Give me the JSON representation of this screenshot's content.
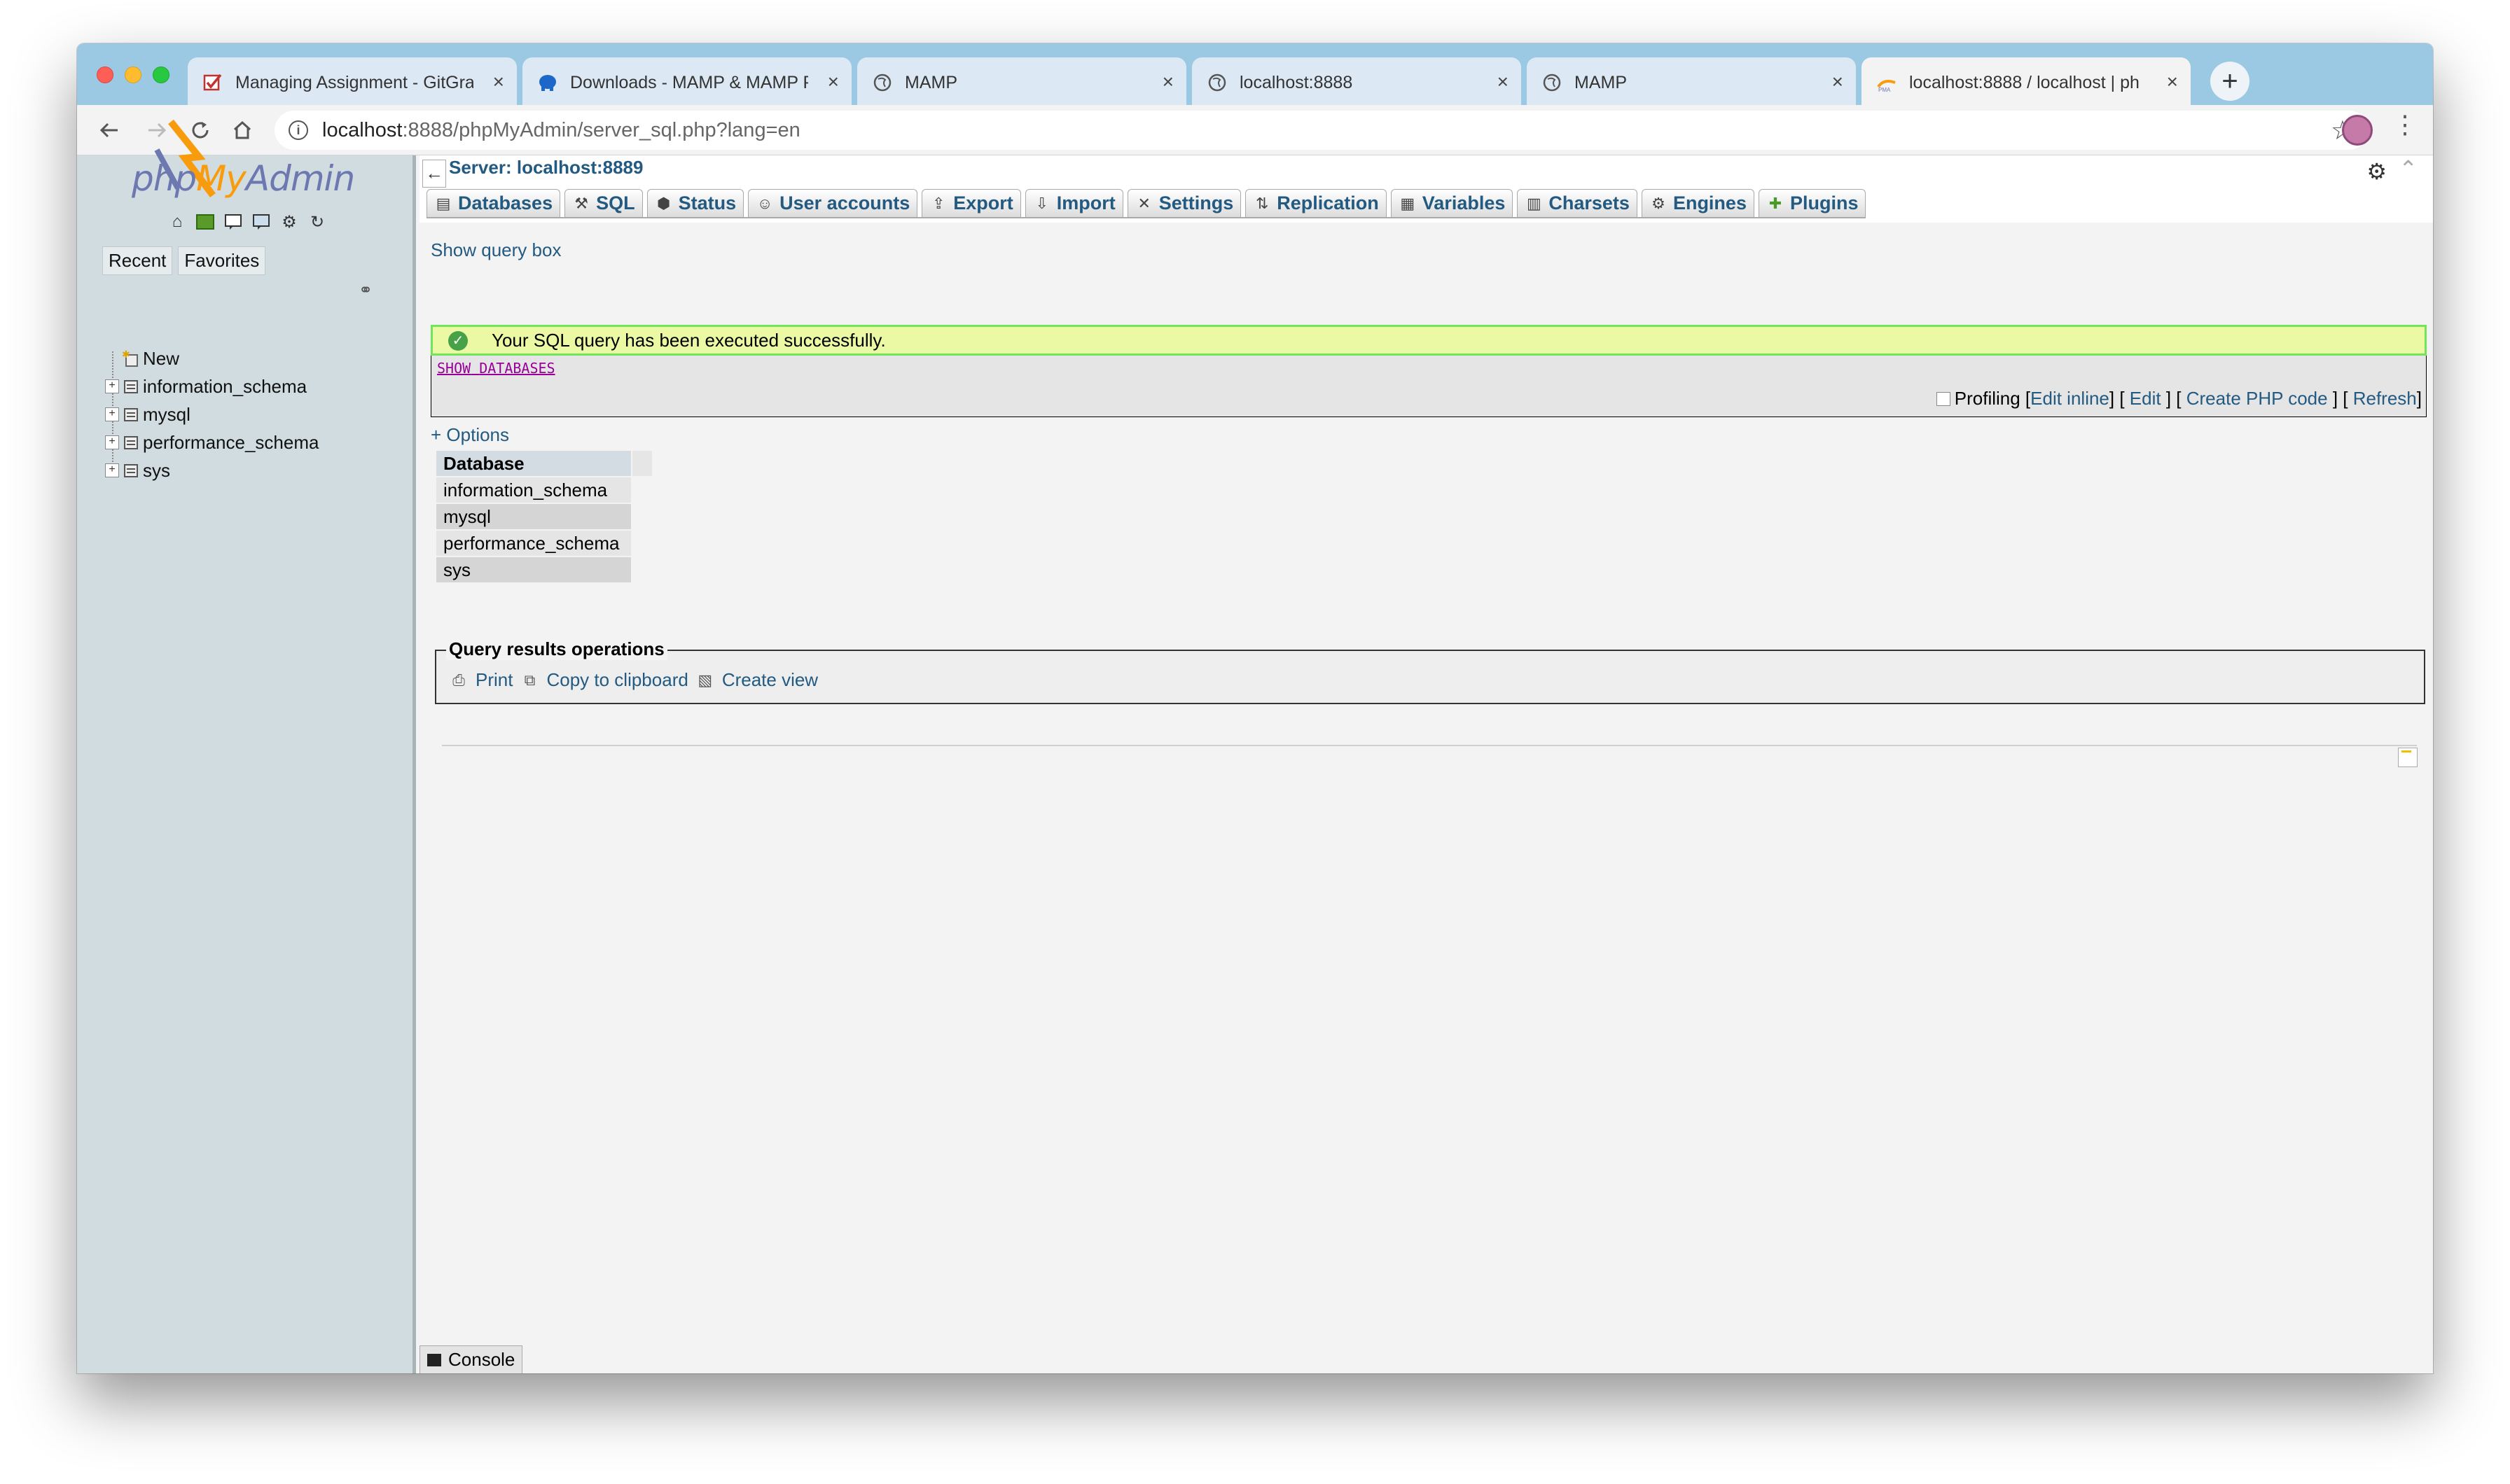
{
  "browser": {
    "tabs": [
      {
        "title": "Managing Assignment - GitGra",
        "icon": "gitgrade-check-icon"
      },
      {
        "title": "Downloads - MAMP & MAMP P",
        "icon": "mamp-elephant-icon"
      },
      {
        "title": "MAMP",
        "icon": "globe-icon"
      },
      {
        "title": "localhost:8888",
        "icon": "globe-icon"
      },
      {
        "title": "MAMP",
        "icon": "globe-icon"
      },
      {
        "title": "localhost:8888 / localhost | ph",
        "icon": "phpmyadmin-icon"
      }
    ],
    "new_tab_label": "+",
    "url_host": "localhost",
    "url_rest": ":8888/phpMyAdmin/server_sql.php?lang=en"
  },
  "nav": {
    "logo_php": "php",
    "logo_my": "My",
    "logo_admin": "Admin",
    "tab_recent": "Recent",
    "tab_favorites": "Favorites",
    "tree": [
      {
        "label": "New",
        "type": "new"
      },
      {
        "label": "information_schema",
        "type": "db"
      },
      {
        "label": "mysql",
        "type": "db"
      },
      {
        "label": "performance_schema",
        "type": "db"
      },
      {
        "label": "sys",
        "type": "db"
      }
    ]
  },
  "main": {
    "server_label": "Server: localhost:8889",
    "menu": [
      {
        "label": "Databases",
        "icon": "databases-icon"
      },
      {
        "label": "SQL",
        "icon": "sql-icon"
      },
      {
        "label": "Status",
        "icon": "status-icon"
      },
      {
        "label": "User accounts",
        "icon": "user-accounts-icon"
      },
      {
        "label": "Export",
        "icon": "export-icon"
      },
      {
        "label": "Import",
        "icon": "import-icon"
      },
      {
        "label": "Settings",
        "icon": "settings-icon"
      },
      {
        "label": "Replication",
        "icon": "replication-icon"
      },
      {
        "label": "Variables",
        "icon": "variables-icon"
      },
      {
        "label": "Charsets",
        "icon": "charsets-icon"
      },
      {
        "label": "Engines",
        "icon": "engines-icon"
      },
      {
        "label": "Plugins",
        "icon": "plugins-icon"
      }
    ],
    "show_query_box": "Show query box",
    "success_message": "Your SQL query has been executed successfully.",
    "sql_keyword_1": "SHOW",
    "sql_keyword_2": "DATABASES",
    "profiling_label": "Profiling",
    "edit_inline": "Edit inline",
    "edit": "Edit",
    "create_php_code": "Create PHP code",
    "refresh": "Refresh",
    "options": "+ Options",
    "table_header": "Database",
    "databases": [
      "information_schema",
      "mysql",
      "performance_schema",
      "sys"
    ],
    "qro_legend": "Query results operations",
    "op_print": "Print",
    "op_copy": "Copy to clipboard",
    "op_create_view": "Create view",
    "console_label": "Console"
  }
}
